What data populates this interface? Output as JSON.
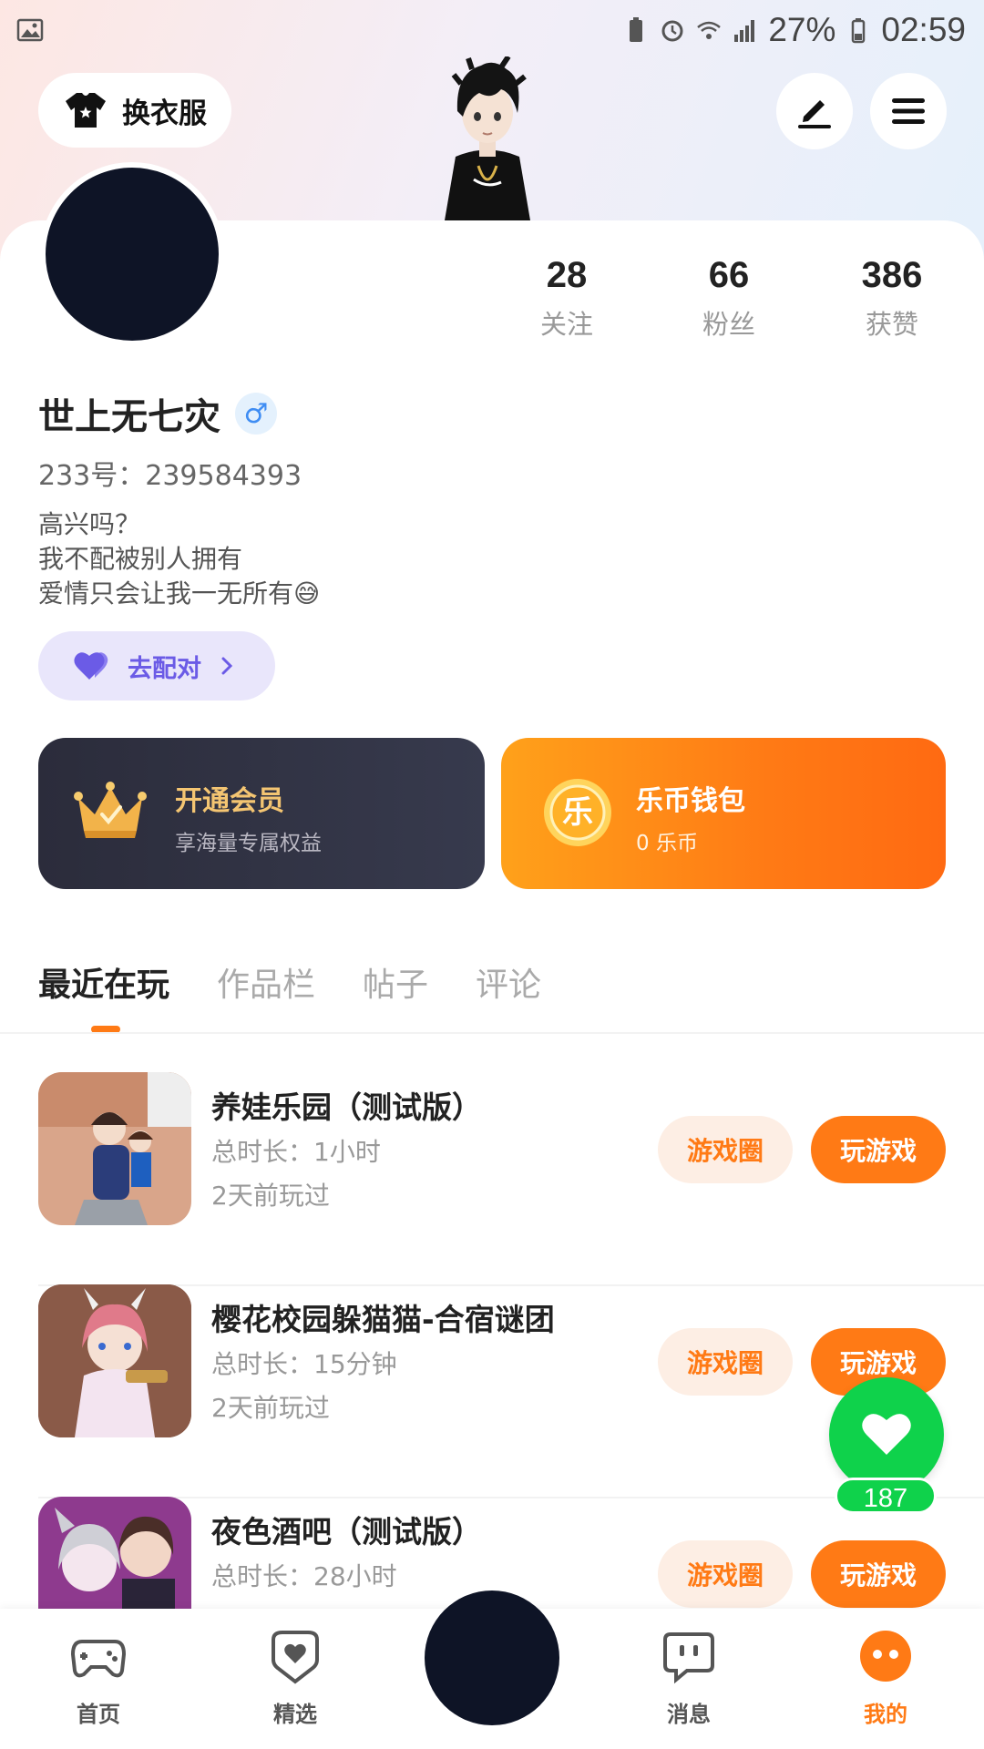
{
  "status_bar": {
    "battery": "27%",
    "time": "02:59"
  },
  "header": {
    "outfit_label": "换衣服"
  },
  "profile": {
    "name": "世上无七灾",
    "gender_symbol": "♂",
    "id_text": "233号：239584393",
    "bio": [
      "高兴吗？",
      "我不配被别人拥有",
      "爱情只会让我一无所有😅"
    ],
    "stats": [
      {
        "num": "28",
        "label": "关注"
      },
      {
        "num": "66",
        "label": "粉丝"
      },
      {
        "num": "386",
        "label": "获赞"
      }
    ],
    "match_label": "去配对"
  },
  "vip": {
    "title": "开通会员",
    "subtitle": "享海量专属权益"
  },
  "wallet": {
    "title": "乐币钱包",
    "subtitle": "0 乐币",
    "coin_char": "乐"
  },
  "tabs": [
    "最近在玩",
    "作品栏",
    "帖子",
    "评论"
  ],
  "games": [
    {
      "title": "养娃乐园（测试版）",
      "duration": "总时长：1小时",
      "last": "2天前玩过",
      "circle_label": "游戏圈",
      "play_label": "玩游戏"
    },
    {
      "title": "樱花校园躲猫猫-合宿谜团",
      "duration": "总时长：15分钟",
      "last": "2天前玩过",
      "circle_label": "游戏圈",
      "play_label": "玩游戏"
    },
    {
      "title": "夜色酒吧（测试版）",
      "duration": "总时长：28小时",
      "last": "",
      "circle_label": "游戏圈",
      "play_label": "玩游戏"
    }
  ],
  "like_count": "187",
  "bottom_nav": [
    {
      "label": "首页",
      "icon": "gamepad-icon"
    },
    {
      "label": "精选",
      "icon": "heart-chat-icon"
    },
    {
      "label": "消息",
      "icon": "message-icon"
    },
    {
      "label": "我的",
      "icon": "profile-face-icon"
    }
  ],
  "colors": {
    "accent": "#ff7a15",
    "vip_gold": "#f4c572",
    "like_green": "#0fd24b",
    "match_purple": "#6b5be6"
  }
}
